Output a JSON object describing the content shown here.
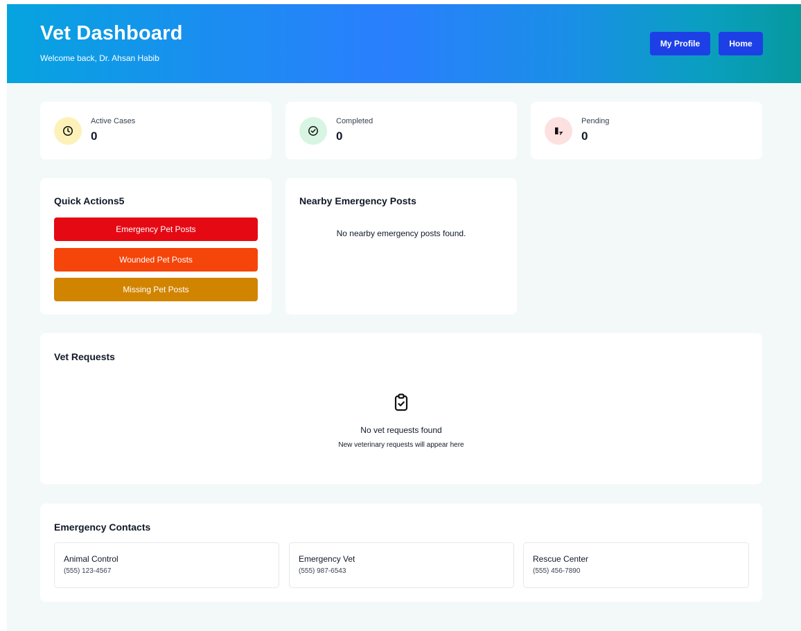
{
  "header": {
    "title": "Vet Dashboard",
    "subtitle": "Welcome back, Dr. Ahsan Habib",
    "profile_button": "My Profile",
    "home_button": "Home"
  },
  "stats": [
    {
      "label": "Active Cases",
      "value": "0",
      "icon": "clock-icon",
      "color": "#fcf2b9"
    },
    {
      "label": "Completed",
      "value": "0",
      "icon": "check-circle-icon",
      "color": "#d7f5e2"
    },
    {
      "label": "Pending",
      "value": "0",
      "icon": "hourglass-icon",
      "color": "#fde0e0"
    }
  ],
  "quick_actions": {
    "title": "Quick Actions5",
    "buttons": [
      {
        "label": "Emergency Pet Posts",
        "color": "#e50914"
      },
      {
        "label": "Wounded Pet Posts",
        "color": "#f5450a"
      },
      {
        "label": "Missing Pet Posts",
        "color": "#d18400"
      }
    ]
  },
  "nearby": {
    "title": "Nearby Emergency Posts",
    "empty_text": "No nearby emergency posts found."
  },
  "vet_requests": {
    "title": "Vet Requests",
    "icon": "clipboard-check-icon",
    "empty_title": "No vet requests found",
    "empty_sub": "New veterinary requests will appear here"
  },
  "contacts": {
    "title": "Emergency Contacts",
    "items": [
      {
        "name": "Animal Control",
        "phone": "(555) 123-4567"
      },
      {
        "name": "Emergency Vet",
        "phone": "(555) 987-6543"
      },
      {
        "name": "Rescue Center",
        "phone": "(555) 456-7890"
      }
    ]
  }
}
